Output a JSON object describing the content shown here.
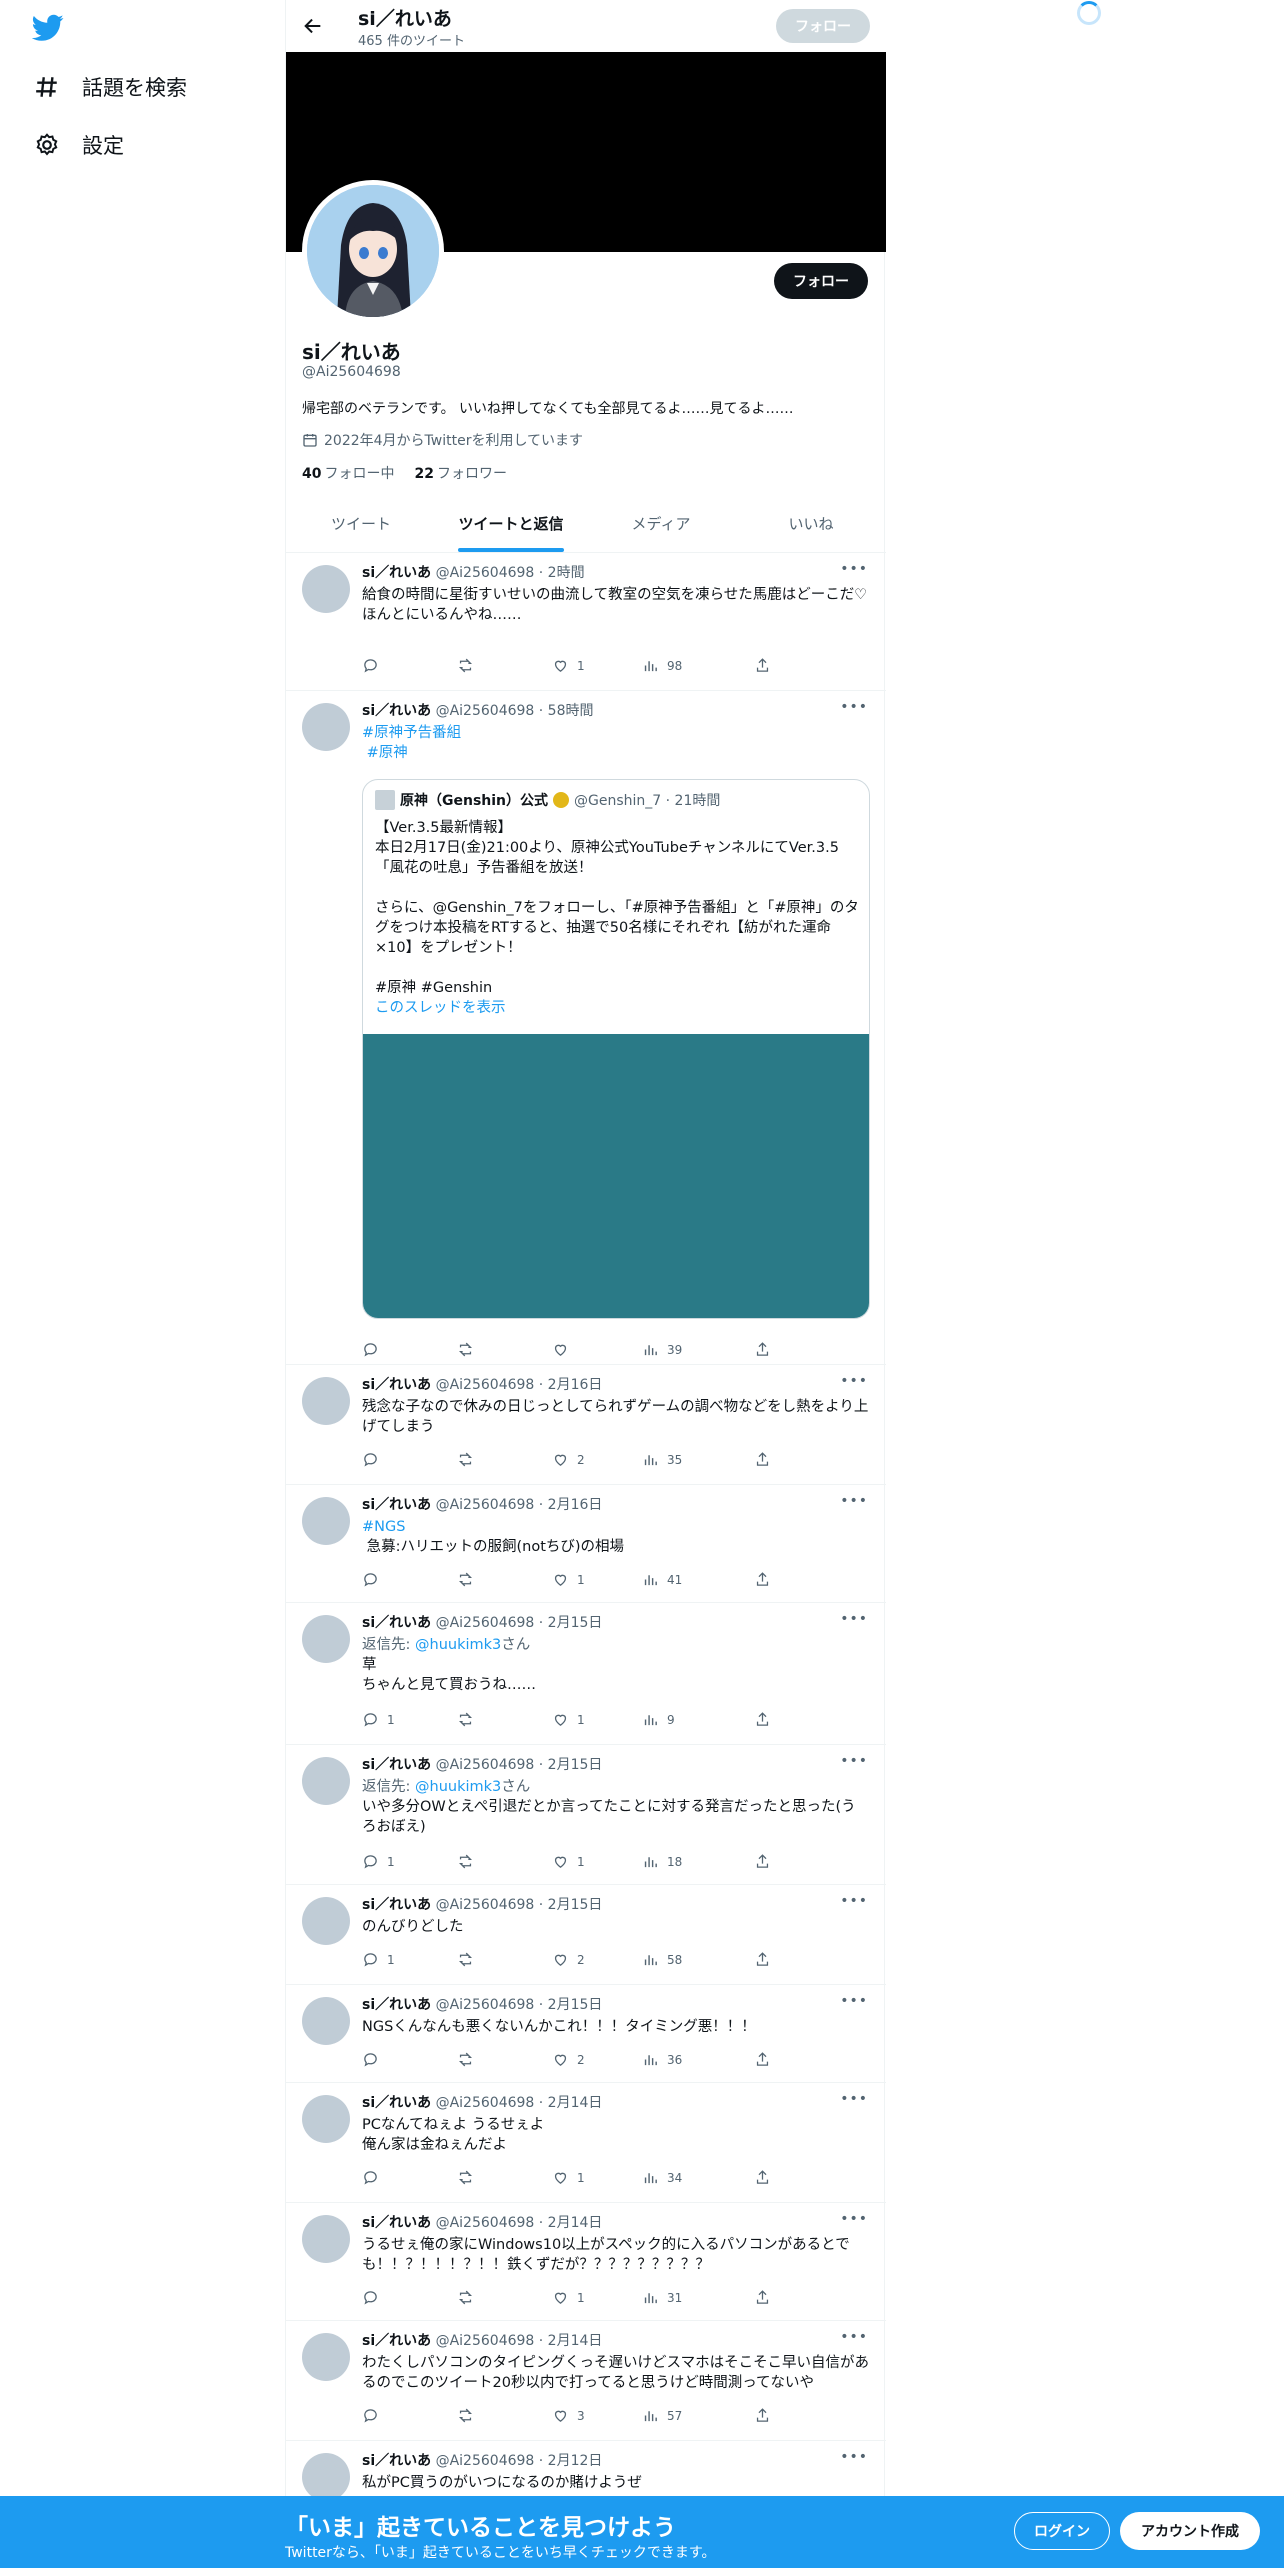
{
  "nav": {
    "explore": "話題を検索",
    "settings": "設定"
  },
  "header": {
    "name": "si／れいあ",
    "tweet_count": "465 件のツイート",
    "follow": "フォロー"
  },
  "profile": {
    "name": "si／れいあ",
    "handle": "@Ai25604698",
    "bio": "帰宅部のベテランです。 いいね押してなくても全部見てるよ……見てるよ……",
    "joined": "2022年4月からTwitterを利用しています",
    "following_count": "40",
    "following_label": "フォロー中",
    "followers_count": "22",
    "followers_label": "フォロワー",
    "follow": "フォロー"
  },
  "tabs": [
    "ツイート",
    "ツイートと返信",
    "メディア",
    "いいね"
  ],
  "tweets": [
    {
      "name": "si／れいあ",
      "meta": "@Ai25604698 · 2時間",
      "text": "給食の時間に星街すいせいの曲流して教室の空気を凍らせた馬鹿はどーこだ♡\nほんとにいるんやね……",
      "reply": "",
      "retweet": "",
      "like": "1",
      "views": "98"
    },
    {
      "name": "si／れいあ",
      "meta": "@Ai25604698 · 58時間",
      "tag1": "#原神予告番組",
      "tag2": "#原神",
      "reply": "",
      "retweet": "",
      "like": "",
      "views": "39",
      "quote": {
        "name": "原神（Genshin）公式",
        "meta": "@Genshin_7 · 21時間",
        "text": "【Ver.3.5最新情報】\n本日2月17日(金)21:00より、原神公式YouTubeチャンネルにてVer.3.5「風花の吐息」予告番組を放送！\n\nさらに、@Genshin_7をフォローし、「#原神予告番組」と「#原神」のタグをつけ本投稿をRTすると、抽選で50名様にそれぞれ【紡がれた運命×10】をプレゼント！\n\n#原神 #Genshin",
        "thread": "このスレッドを表示"
      }
    },
    {
      "name": "si／れいあ",
      "meta": "@Ai25604698 · 2月16日",
      "text": "残念な子なので休みの日じっとしてられずゲームの調べ物などをし熱をより上げてしまう",
      "reply": "",
      "retweet": "",
      "like": "2",
      "views": "35"
    },
    {
      "name": "si／れいあ",
      "meta": "@Ai25604698 · 2月16日",
      "tag1": "#NGS",
      "text": " 急募:ハリエットの服飼(notちび)の相場",
      "reply": "",
      "retweet": "",
      "like": "1",
      "views": "41"
    },
    {
      "name": "si／れいあ",
      "meta": "@Ai25604698 · 2月15日",
      "reply_to_label": "返信先: ",
      "reply_to": "@huukimk3",
      "reply_to_suffix": "さん",
      "text": "草\nちゃんと見て買おうね……",
      "reply": "1",
      "retweet": "",
      "like": "1",
      "views": "9"
    },
    {
      "name": "si／れいあ",
      "meta": "@Ai25604698 · 2月15日",
      "reply_to_label": "返信先: ",
      "reply_to": "@huukimk3",
      "reply_to_suffix": "さん",
      "text": "いや多分OWとえぺ引退だとか言ってたことに対する発言だったと思った(うろおぼえ)",
      "reply": "1",
      "retweet": "",
      "like": "1",
      "views": "18"
    },
    {
      "name": "si／れいあ",
      "meta": "@Ai25604698 · 2月15日",
      "text": "のんびりどした",
      "reply": "1",
      "retweet": "",
      "like": "2",
      "views": "58"
    },
    {
      "name": "si／れいあ",
      "meta": "@Ai25604698 · 2月15日",
      "text": "NGSくんなんも悪くないんかこれ！！！タイミング悪！！！",
      "reply": "",
      "retweet": "",
      "like": "2",
      "views": "36"
    },
    {
      "name": "si／れいあ",
      "meta": "@Ai25604698 · 2月14日",
      "text": "PCなんてねぇよ うるせぇよ\n俺ん家は金ねぇんだよ",
      "reply": "",
      "retweet": "",
      "like": "1",
      "views": "34"
    },
    {
      "name": "si／れいあ",
      "meta": "@Ai25604698 · 2月14日",
      "text": "うるせぇ俺の家にWindows10以上がスペック的に入るパソコンがあるとでも！！？！！！？！！鉄くずだが？？？？？？？？？",
      "reply": "",
      "retweet": "",
      "like": "1",
      "views": "31"
    },
    {
      "name": "si／れいあ",
      "meta": "@Ai25604698 · 2月14日",
      "text": "わたくしパソコンのタイピングくっそ遅いけどスマホはそこそこ早い自信があるのでこのツイート20秒以内で打ってると思うけど時間測ってないや",
      "reply": "",
      "retweet": "",
      "like": "3",
      "views": "57"
    },
    {
      "name": "si／れいあ",
      "meta": "@Ai25604698 · 2月12日",
      "text": "私がPC買うのがいつになるのか賭けようぜ"
    }
  ],
  "bottom_bar": {
    "title": "「いま」起きていることを見つけよう",
    "subtitle": "Twitterなら、「いま」起きていることをいち早くチェックできます。",
    "login": "ログイン",
    "signup": "アカウント作成"
  },
  "colors": {
    "accent": "#1d9bf0",
    "text": "#0f1419",
    "muted": "#536471",
    "media": "#2a7a87"
  }
}
